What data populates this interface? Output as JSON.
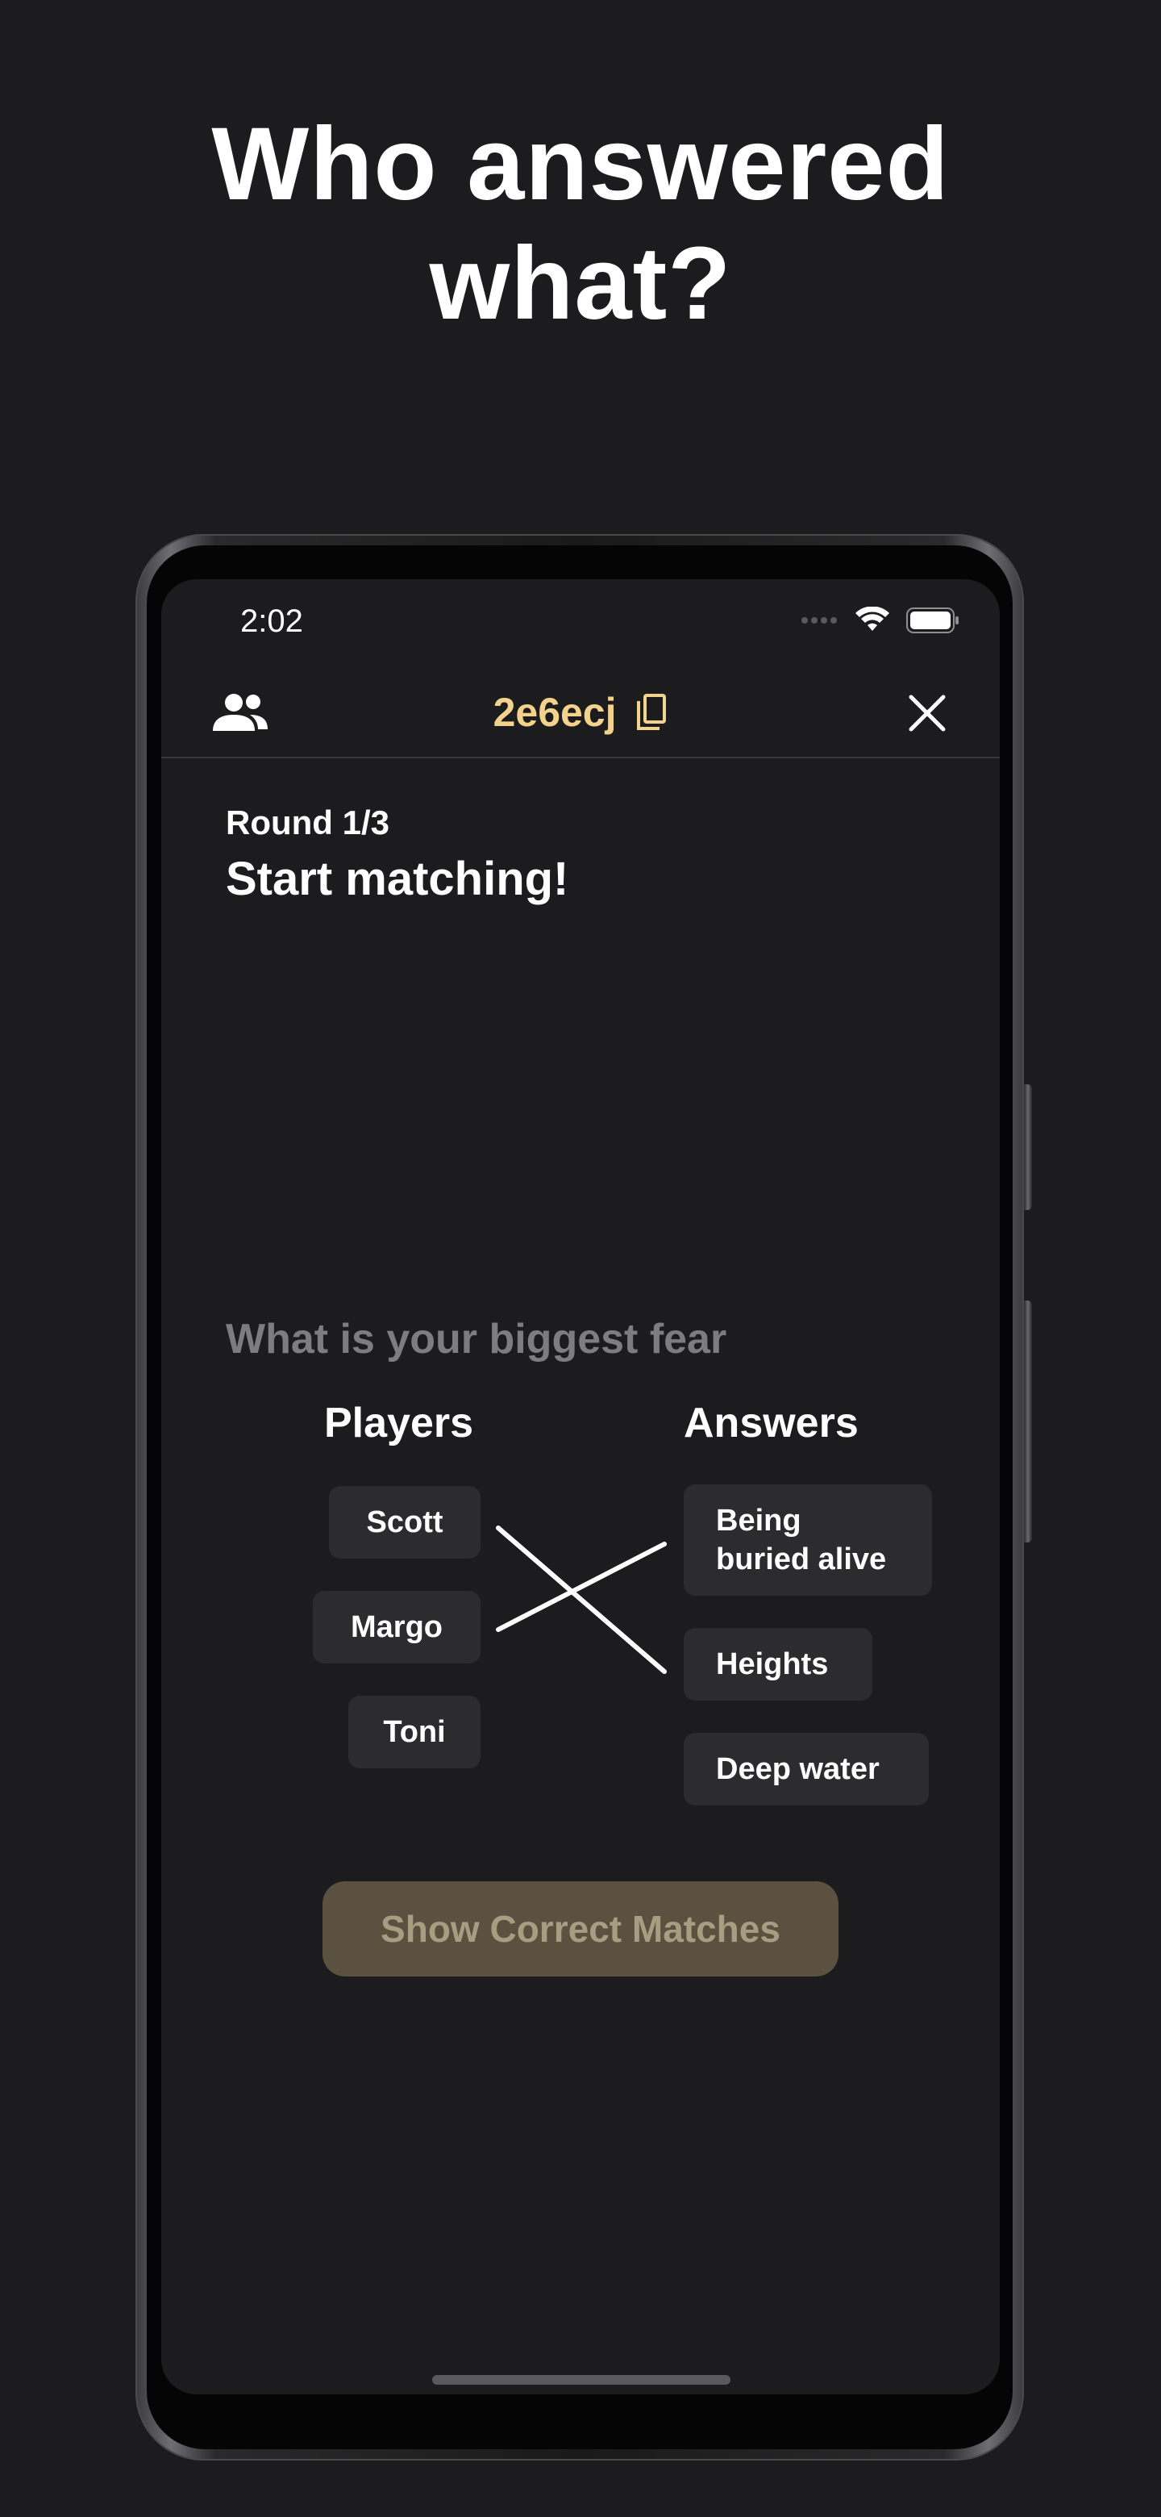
{
  "headline": {
    "line1": "Who answered",
    "line2": "what?"
  },
  "status_bar": {
    "time": "2:02"
  },
  "nav": {
    "room_code": "2e6ecj",
    "left_icon": "people-icon",
    "copy_icon": "copy-icon",
    "close_icon": "close-icon"
  },
  "round": {
    "label": "Round 1/3",
    "title": "Start matching!"
  },
  "question": "What is your biggest fear",
  "columns": {
    "players_header": "Players",
    "answers_header": "Answers"
  },
  "players": [
    "Scott",
    "Margo",
    "Toni"
  ],
  "answers": [
    {
      "line1": "Being",
      "line2": "buried alive"
    },
    {
      "line1": "Heights"
    },
    {
      "line1": "Deep water"
    }
  ],
  "matches": [
    {
      "player": "Scott",
      "answer": "Heights"
    },
    {
      "player": "Margo",
      "answer": "Being buried alive"
    }
  ],
  "button": {
    "label": "Show Correct Matches"
  },
  "colors": {
    "background": "#1c1c1e",
    "accent": "#f2d28c",
    "chip": "#2c2c2e",
    "button": "#5a5141",
    "muted_text": "#7d7d80"
  }
}
